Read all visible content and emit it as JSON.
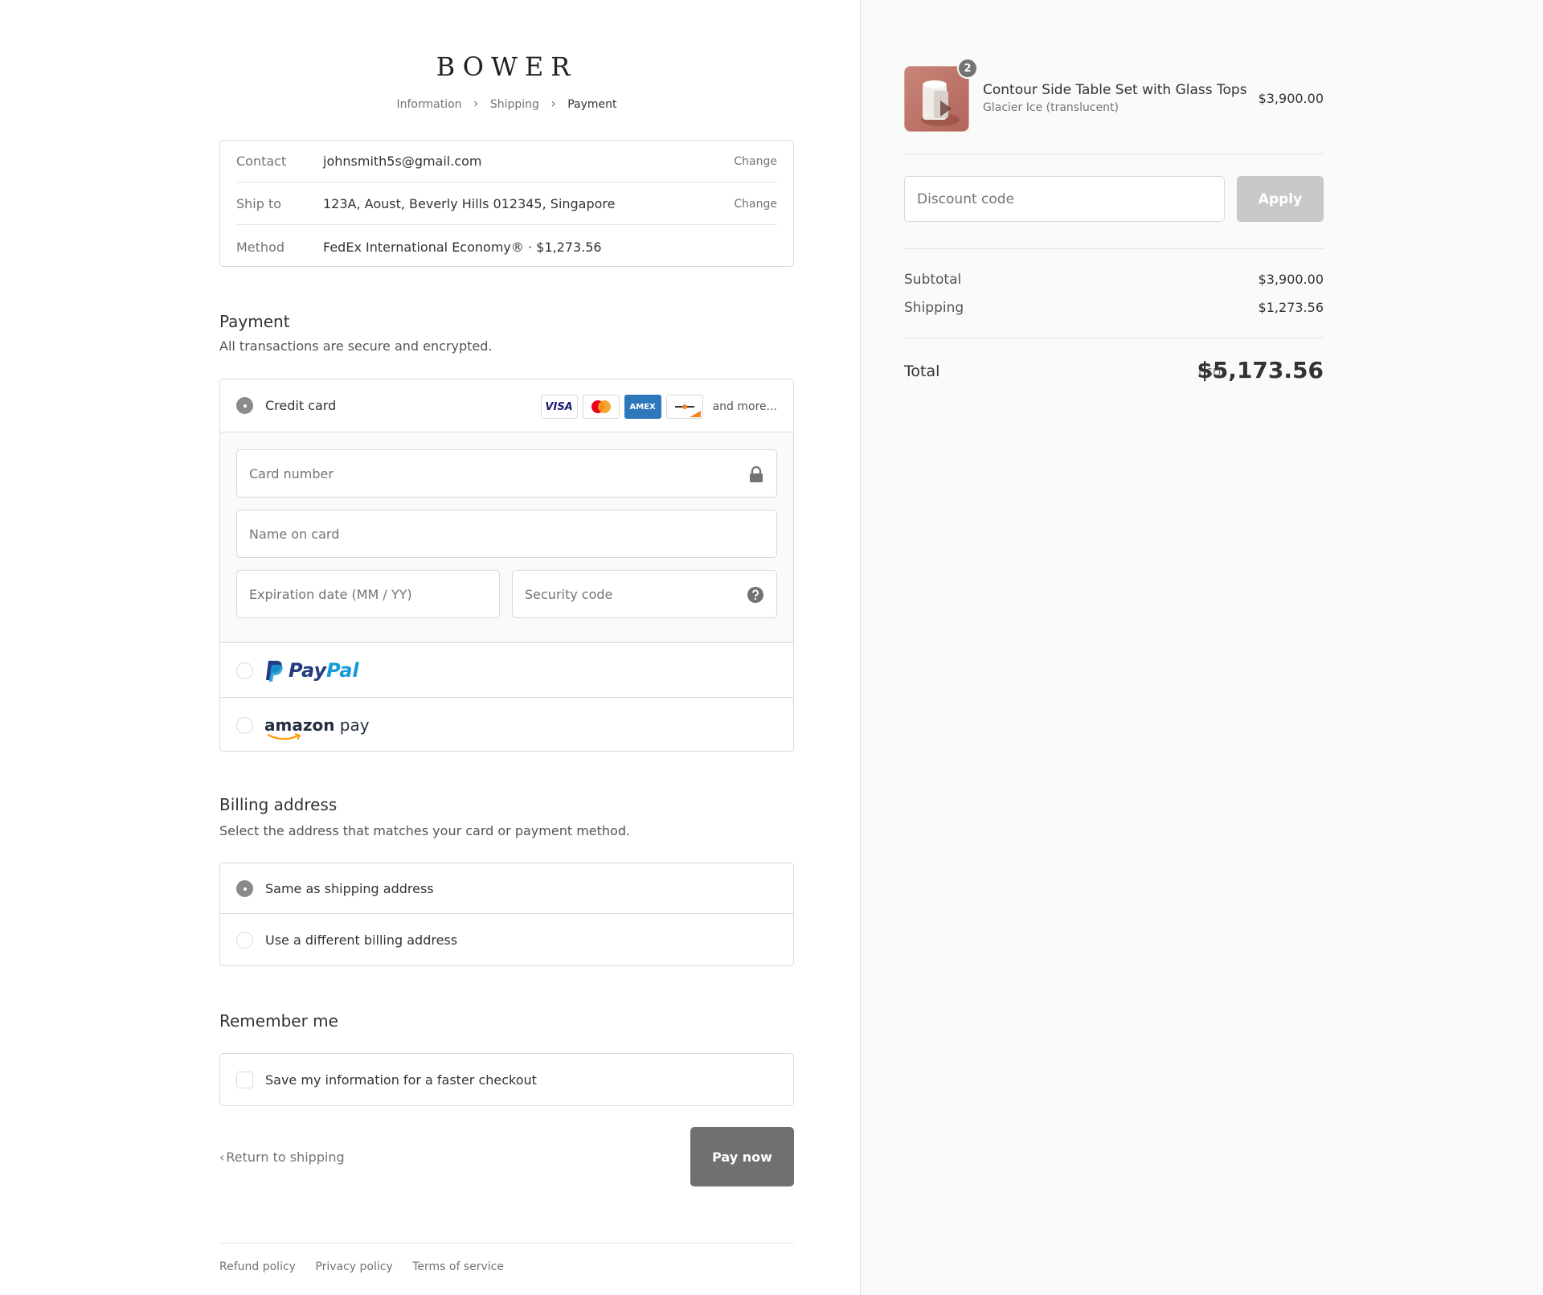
{
  "brand": {
    "logo": "BOWER"
  },
  "breadcrumb": {
    "items": [
      "Information",
      "Shipping",
      "Payment"
    ],
    "separator": "›"
  },
  "review": {
    "rows": [
      {
        "label": "Contact",
        "value": "johnsmith5s@gmail.com",
        "action": "Change"
      },
      {
        "label": "Ship to",
        "value": "123A, Aoust, Beverly Hills 012345, Singapore",
        "action": "Change"
      },
      {
        "label": "Method",
        "value": "FedEx International Economy® · ",
        "price": "$1,273.56"
      }
    ]
  },
  "payment": {
    "title": "Payment",
    "subtitle": "All transactions are secure and encrypted.",
    "credit_card_label": "Credit card",
    "card_brands": [
      "VISA",
      "mastercard",
      "AMEX",
      "discover"
    ],
    "more_label": "and more...",
    "fields": {
      "card_number": "Card number",
      "name_on_card": "Name on card",
      "expiration": "Expiration date (MM / YY)",
      "security_code": "Security code"
    },
    "paypal": {
      "pay": "Pay",
      "pal": "Pal"
    },
    "amazon": {
      "brand": "amazon",
      "suffix": " pay"
    }
  },
  "billing": {
    "title": "Billing address",
    "subtitle": "Select the address that matches your card or payment method.",
    "options": [
      "Same as shipping address",
      "Use a different billing address"
    ]
  },
  "remember": {
    "title": "Remember me",
    "checkbox_label": "Save my information for a faster checkout"
  },
  "actions": {
    "return_label": "Return to shipping",
    "pay_label": "Pay now"
  },
  "footer": {
    "links": [
      "Refund policy",
      "Privacy policy",
      "Terms of service"
    ]
  },
  "summary": {
    "product": {
      "name": "Contour Side Table Set with Glass Tops",
      "variant": "Glacier Ice (translucent)",
      "price": "$3,900.00",
      "quantity": "2"
    },
    "discount_placeholder": "Discount code",
    "apply_label": "Apply",
    "subtotal_label": "Subtotal",
    "subtotal": "$3,900.00",
    "shipping_label": "Shipping",
    "shipping": "$1,273.56",
    "total_label": "Total",
    "currency": "USD",
    "total": "$5,173.56"
  },
  "colors": {
    "pay_button": "#707070",
    "apply_button": "#c8c8c8",
    "paypal_dark": "#253b80",
    "paypal_light": "#179bd7",
    "amex": "#2e77bc"
  }
}
